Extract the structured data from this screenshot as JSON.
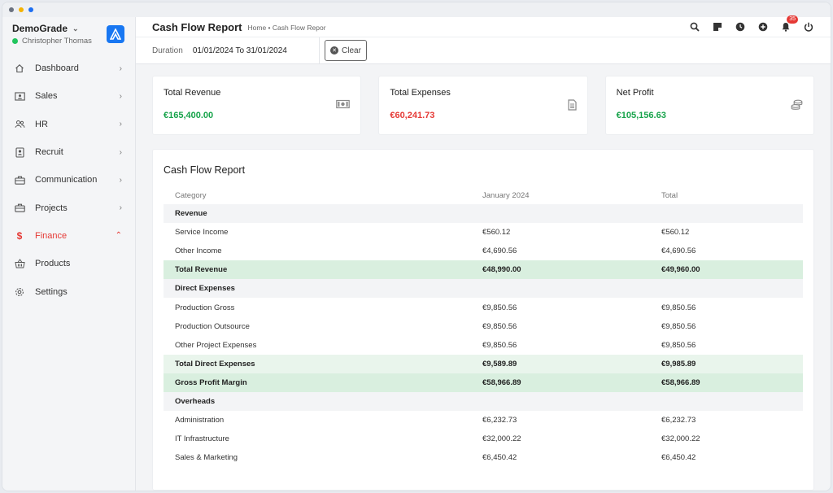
{
  "sidebar": {
    "org_name": "DemoGrade",
    "user_name": "Christopher Thomas",
    "items": [
      {
        "label": "Dashboard",
        "icon": "home-icon"
      },
      {
        "label": "Sales",
        "icon": "id-card-icon"
      },
      {
        "label": "HR",
        "icon": "users-icon"
      },
      {
        "label": "Recruit",
        "icon": "badge-icon"
      },
      {
        "label": "Communication",
        "icon": "briefcase-icon"
      },
      {
        "label": "Projects",
        "icon": "briefcase-icon"
      },
      {
        "label": "Finance",
        "icon": "dollar-icon",
        "active": true
      },
      {
        "label": "Products",
        "icon": "basket-icon"
      },
      {
        "label": "Settings",
        "icon": "gear-icon"
      }
    ]
  },
  "header": {
    "title": "Cash Flow Report",
    "breadcrumb": "Home • Cash Flow Repor",
    "notification_count": "35"
  },
  "filter": {
    "duration_label": "Duration",
    "duration_value": "01/01/2024 To 31/01/2024",
    "clear_label": "Clear"
  },
  "cards": [
    {
      "title": "Total Revenue",
      "value": "€165,400.00",
      "icon": "cash-icon",
      "color": "#16a34a"
    },
    {
      "title": "Total Expenses",
      "value": "€60,241.73",
      "icon": "document-icon",
      "color": "#e53935"
    },
    {
      "title": "Net Profit",
      "value": "€105,156.63",
      "icon": "coins-icon",
      "color": "#16a34a"
    }
  ],
  "report": {
    "title": "Cash Flow Report",
    "columns": [
      "Category",
      "January 2024",
      "Total"
    ],
    "rows": [
      {
        "type": "section",
        "cells": [
          "Revenue",
          "",
          ""
        ]
      },
      {
        "type": "row",
        "cells": [
          "Service Income",
          "€560.12",
          "€560.12"
        ]
      },
      {
        "type": "row",
        "cells": [
          "Other Income",
          "€4,690.56",
          "€4,690.56"
        ]
      },
      {
        "type": "total",
        "cells": [
          "Total Revenue",
          "€48,990.00",
          "€49,960.00"
        ]
      },
      {
        "type": "section",
        "cells": [
          "Direct Expenses",
          "",
          ""
        ]
      },
      {
        "type": "row",
        "cells": [
          "Production Gross",
          "€9,850.56",
          "€9,850.56"
        ]
      },
      {
        "type": "row",
        "cells": [
          "Production Outsource",
          "€9,850.56",
          "€9,850.56"
        ]
      },
      {
        "type": "row",
        "cells": [
          "Other Project Expenses",
          "€9,850.56",
          "€9,850.56"
        ]
      },
      {
        "type": "total-light",
        "cells": [
          "Total Direct Expenses",
          "€9,589.89",
          "€9,985.89"
        ]
      },
      {
        "type": "total",
        "cells": [
          "Gross Profit Margin",
          "€58,966.89",
          "€58,966.89"
        ]
      },
      {
        "type": "section",
        "cells": [
          "Overheads",
          "",
          ""
        ]
      },
      {
        "type": "row",
        "cells": [
          "Administration",
          "€6,232.73",
          "€6,232.73"
        ]
      },
      {
        "type": "row",
        "cells": [
          "IT Infrastructure",
          "€32,000.22",
          "€32,000.22"
        ]
      },
      {
        "type": "row",
        "cells": [
          "Sales & Marketing",
          "€6,450.42",
          "€6,450.42"
        ]
      }
    ]
  }
}
